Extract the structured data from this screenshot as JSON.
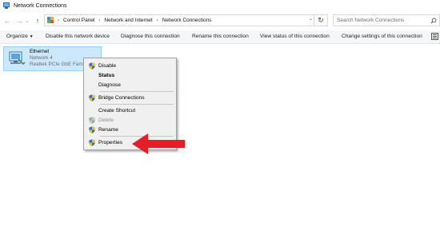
{
  "window": {
    "title": "Network Connections",
    "icon": "network-connections-icon"
  },
  "navigation": {
    "back_icon": "arrow-left-icon",
    "forward_icon": "arrow-right-icon",
    "recent_icon": "chevron-down-icon",
    "up_icon": "arrow-up-icon",
    "breadcrumb": [
      "Control Panel",
      "Network and Internet",
      "Network Connections"
    ],
    "refresh_icon": "refresh-icon",
    "search_placeholder": "Search Network Connections"
  },
  "commands": {
    "organize": "Organize",
    "disable": "Disable this network device",
    "diagnose": "Diagnose this connection",
    "rename": "Rename this connection",
    "view_status": "View status of this connection",
    "change_settings": "Change settings of this connection"
  },
  "connection": {
    "name": "Ethernet",
    "network": "Network 4",
    "adapter": "Realtek PCIe GbE Family"
  },
  "context_menu": {
    "disable": "Disable",
    "status": "Status",
    "diagnose": "Diagnose",
    "bridge": "Bridge Connections",
    "shortcut": "Create Shortcut",
    "delete": "Delete",
    "rename": "Rename",
    "properties": "Properties"
  },
  "colors": {
    "selection_bg": "#cce8ff",
    "selection_border": "#99d1ff",
    "menu_bg": "#f0f0f0",
    "annotation_arrow": "#e41e26"
  }
}
